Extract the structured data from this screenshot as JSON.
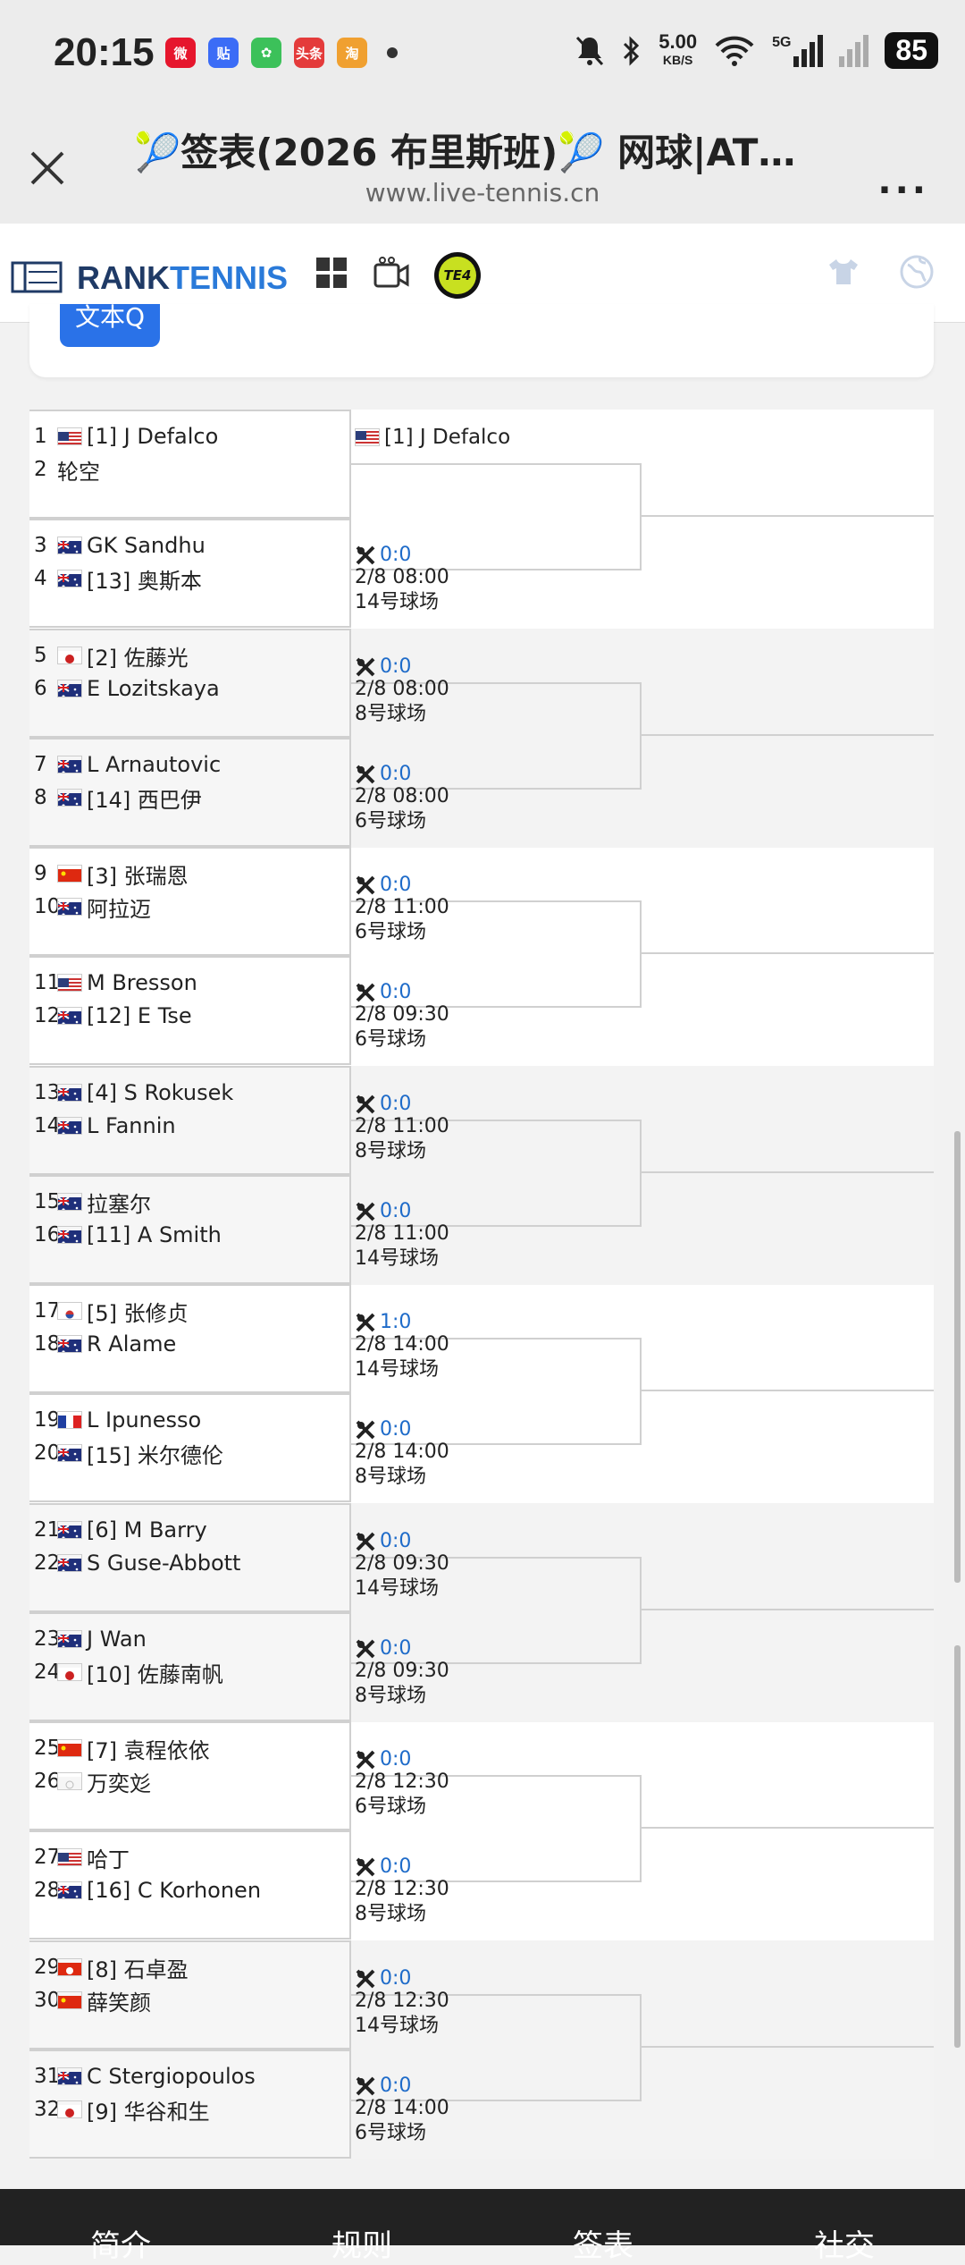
{
  "status": {
    "time": "20:15",
    "speed": "5.00",
    "speed_unit": "KB/S",
    "network": "5G",
    "battery": "85",
    "apps": [
      {
        "name": "weibo",
        "color": "#e6162d",
        "glyph": "微"
      },
      {
        "name": "tieba",
        "color": "#3b6cf6",
        "glyph": "贴"
      },
      {
        "name": "qimai",
        "color": "#3cc15a",
        "glyph": "✿"
      },
      {
        "name": "toutiao",
        "color": "#e43b3b",
        "glyph": "头条"
      },
      {
        "name": "taobao",
        "color": "#f0a030",
        "glyph": "淘"
      }
    ]
  },
  "browser": {
    "title": "🎾签表(2026 布里斯班)🎾 网球|ATP...",
    "url": "www.live-tennis.cn",
    "more": "..."
  },
  "site": {
    "logo_rank": "RANK",
    "logo_tennis": "TENNIS",
    "te4_label": "TE4"
  },
  "topcard": {
    "button_label": "文本Q"
  },
  "winner": {
    "flag": "us",
    "name": "[1] J Defalco"
  },
  "colors": {
    "accent": "#2a72e8",
    "link": "#1e6bc9",
    "border": "#d0d0d0"
  },
  "players": [
    {
      "num": "1",
      "flag": "us",
      "name": "[1] J Defalco"
    },
    {
      "num": "2",
      "flag": "",
      "name": "轮空"
    },
    {
      "num": "3",
      "flag": "au",
      "name": "GK Sandhu"
    },
    {
      "num": "4",
      "flag": "au",
      "name": "[13] 奥斯本"
    },
    {
      "num": "5",
      "flag": "jp",
      "name": "[2] 佐藤光"
    },
    {
      "num": "6",
      "flag": "au",
      "name": "E Lozitskaya"
    },
    {
      "num": "7",
      "flag": "au",
      "name": "L Arnautovic"
    },
    {
      "num": "8",
      "flag": "au",
      "name": "[14] 西巴伊"
    },
    {
      "num": "9",
      "flag": "cn",
      "name": "[3] 张瑞恩"
    },
    {
      "num": "10",
      "flag": "au",
      "name": "阿拉迈"
    },
    {
      "num": "11",
      "flag": "us",
      "name": "M Bresson"
    },
    {
      "num": "12",
      "flag": "au",
      "name": "[12] E Tse"
    },
    {
      "num": "13",
      "flag": "au",
      "name": "[4] S Rokusek"
    },
    {
      "num": "14",
      "flag": "au",
      "name": "L Fannin"
    },
    {
      "num": "15",
      "flag": "au",
      "name": "拉塞尔"
    },
    {
      "num": "16",
      "flag": "au",
      "name": "[11] A Smith"
    },
    {
      "num": "17",
      "flag": "kr",
      "name": "[5] 张修贞"
    },
    {
      "num": "18",
      "flag": "au",
      "name": "R Alame"
    },
    {
      "num": "19",
      "flag": "fr",
      "name": "L Ipunesso"
    },
    {
      "num": "20",
      "flag": "au",
      "name": "[15] 米尔德伦"
    },
    {
      "num": "21",
      "flag": "au",
      "name": "[6] M Barry"
    },
    {
      "num": "22",
      "flag": "au",
      "name": "S Guse-Abbott"
    },
    {
      "num": "23",
      "flag": "au",
      "name": "J Wan"
    },
    {
      "num": "24",
      "flag": "jp",
      "name": "[10] 佐藤南帆"
    },
    {
      "num": "25",
      "flag": "cn",
      "name": "[7] 袁程依依"
    },
    {
      "num": "26",
      "flag": "mo",
      "name": "万奕彣"
    },
    {
      "num": "27",
      "flag": "us",
      "name": "哈丁"
    },
    {
      "num": "28",
      "flag": "au",
      "name": "[16] C Korhonen"
    },
    {
      "num": "29",
      "flag": "hk",
      "name": "[8] 石卓盈"
    },
    {
      "num": "30",
      "flag": "cn",
      "name": "薛笑颜"
    },
    {
      "num": "31",
      "flag": "au",
      "name": "C Stergiopoulos"
    },
    {
      "num": "32",
      "flag": "jp",
      "name": "[9] 华谷和生"
    }
  ],
  "matches": [
    {
      "score": "0:0",
      "time": "2/8 08:00",
      "court": "14号球场"
    },
    {
      "score": "0:0",
      "time": "2/8 08:00",
      "court": "8号球场"
    },
    {
      "score": "0:0",
      "time": "2/8 08:00",
      "court": "6号球场"
    },
    {
      "score": "0:0",
      "time": "2/8 11:00",
      "court": "6号球场"
    },
    {
      "score": "0:0",
      "time": "2/8 09:30",
      "court": "6号球场"
    },
    {
      "score": "0:0",
      "time": "2/8 11:00",
      "court": "8号球场"
    },
    {
      "score": "0:0",
      "time": "2/8 11:00",
      "court": "14号球场"
    },
    {
      "score": "1:0",
      "time": "2/8 14:00",
      "court": "14号球场"
    },
    {
      "score": "0:0",
      "time": "2/8 14:00",
      "court": "8号球场"
    },
    {
      "score": "0:0",
      "time": "2/8 09:30",
      "court": "14号球场"
    },
    {
      "score": "0:0",
      "time": "2/8 09:30",
      "court": "8号球场"
    },
    {
      "score": "0:0",
      "time": "2/8 12:30",
      "court": "6号球场"
    },
    {
      "score": "0:0",
      "time": "2/8 12:30",
      "court": "8号球场"
    },
    {
      "score": "0:0",
      "time": "2/8 12:30",
      "court": "14号球场"
    },
    {
      "score": "0:0",
      "time": "2/8 14:00",
      "court": "6号球场"
    }
  ],
  "bottomnav": [
    "简介",
    "规则",
    "签表",
    "社交"
  ]
}
